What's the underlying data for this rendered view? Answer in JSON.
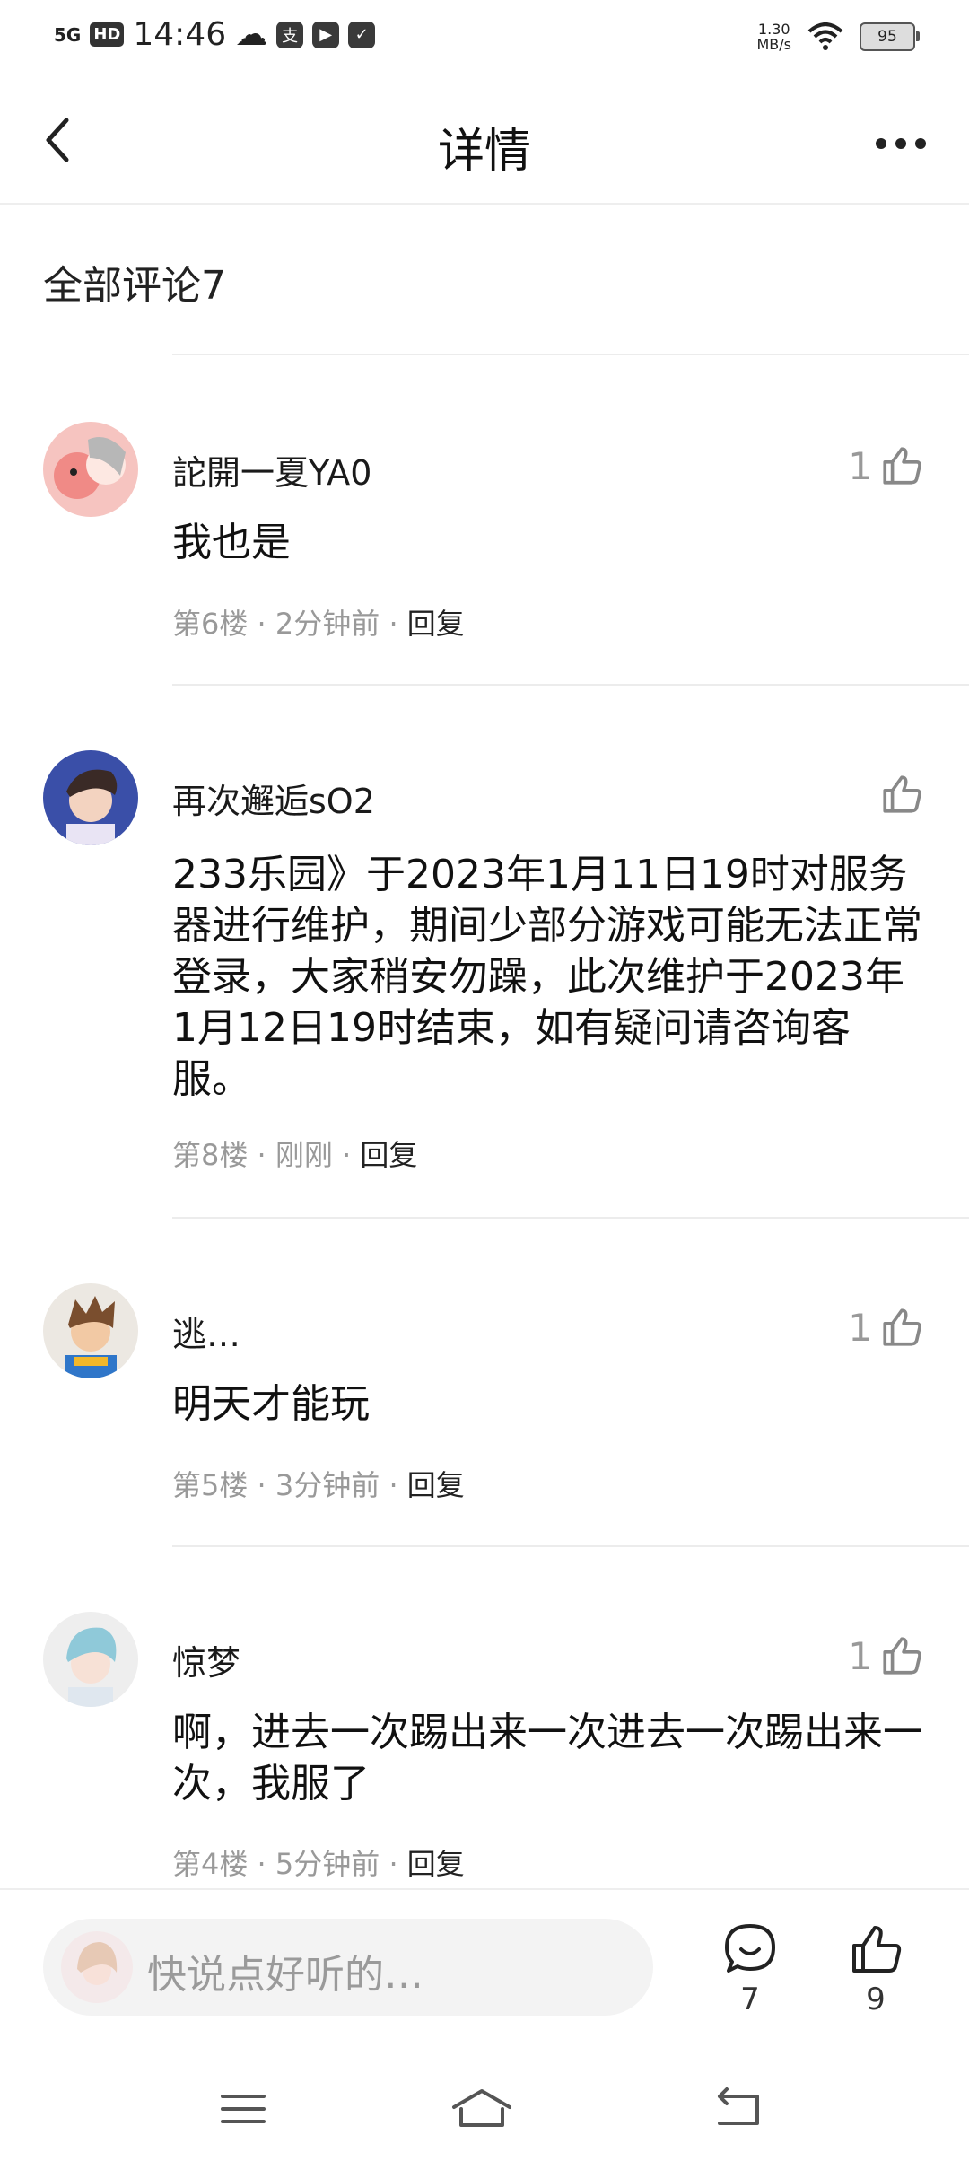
{
  "status_bar": {
    "signal": "5G",
    "hd": "HD",
    "time": "14:46",
    "speed_value": "1.30",
    "speed_unit": "MB/s",
    "battery": "95"
  },
  "header": {
    "title": "详情"
  },
  "comments_section": {
    "title": "全部评论7"
  },
  "comments": [
    {
      "username": "詑開一夏YA0",
      "content": "我也是",
      "floor": "第6楼",
      "time": "2分钟前",
      "reply": "回复",
      "likes": "1"
    },
    {
      "username": "再次邂逅sO2",
      "content": "233乐园》于2023年1月11日19时对服务器进行维护，期间少部分游戏可能无法正常登录，大家稍安勿躁，此次维护于2023年1月12日19时结束，如有疑问请咨询客服。",
      "floor": "第8楼",
      "time": "刚刚",
      "reply": "回复",
      "likes": ""
    },
    {
      "username": "逃…",
      "content": "明天才能玩",
      "floor": "第5楼",
      "time": "3分钟前",
      "reply": "回复",
      "likes": "1"
    },
    {
      "username": "惊梦",
      "content": "啊，进去一次踢出来一次进去一次踢出来一次，我服了",
      "floor": "第4楼",
      "time": "5分钟前",
      "reply": "回复",
      "likes": "1"
    }
  ],
  "meta_separator": "·",
  "bottom_bar": {
    "input_placeholder": "快说点好听的…",
    "comment_count": "7",
    "like_count": "9"
  }
}
